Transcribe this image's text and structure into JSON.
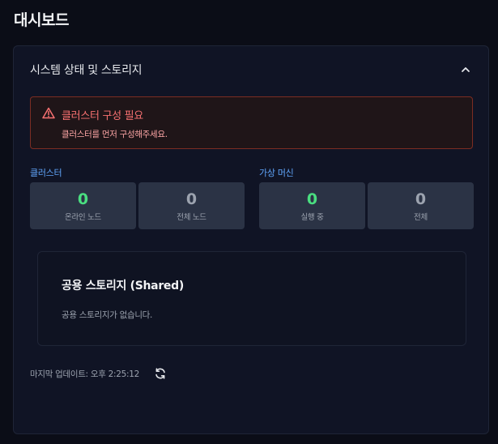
{
  "page": {
    "title": "대시보드"
  },
  "panel": {
    "title": "시스템 상태 및 스토리지",
    "alert": {
      "title": "클러스터 구성 필요",
      "message": "클러스터를 먼저 구성해주세요."
    },
    "cluster": {
      "label": "클러스터",
      "stats": [
        {
          "value": "0",
          "label": "온라인 노드"
        },
        {
          "value": "0",
          "label": "전체 노드"
        }
      ]
    },
    "vms": {
      "label": "가상 머신",
      "stats": [
        {
          "value": "0",
          "label": "실행 중"
        },
        {
          "value": "0",
          "label": "전체"
        }
      ]
    },
    "storage": {
      "title": "공용 스토리지 (Shared)",
      "empty": "공용 스토리지가 없습니다."
    },
    "last_updated": "마지막 업데이트: 오후 2:25:12"
  },
  "colors": {
    "accent": "#60a5fa",
    "success": "#4ade80",
    "danger": "#f87171"
  },
  "icons": {
    "collapse": "chevron-up-icon",
    "alert": "warning-triangle-icon",
    "refresh": "refresh-icon"
  }
}
